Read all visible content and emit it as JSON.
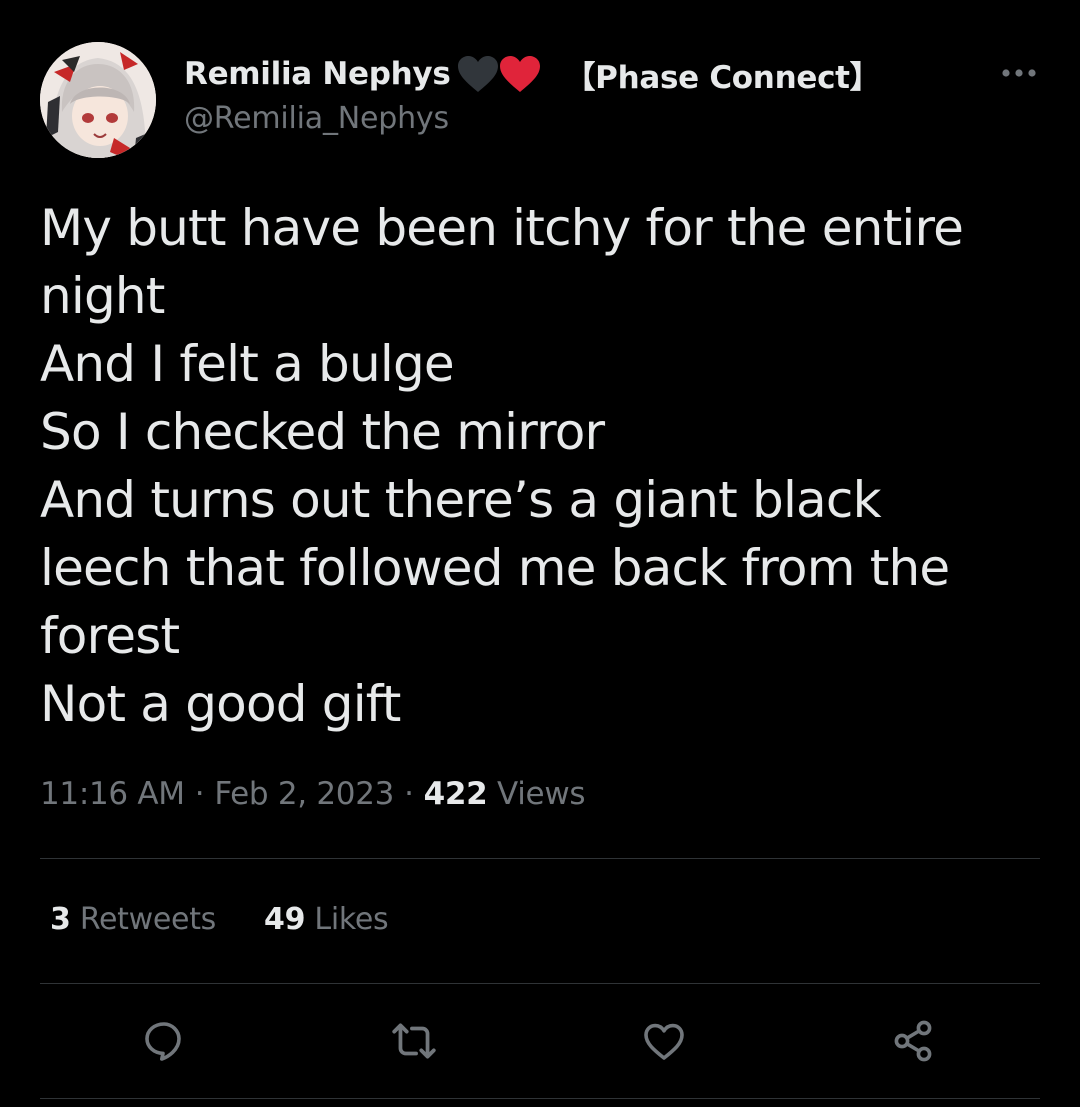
{
  "author": {
    "display_name": "Remilia Nephys",
    "tag": "【Phase Connect】",
    "handle": "@Remilia_Nephys",
    "emoji": [
      "black-heart-icon",
      "red-heart-icon"
    ]
  },
  "tweet": {
    "lines": [
      "My butt have been itchy for the entire",
      "night",
      "And I felt a bulge",
      "So I checked the mirror",
      "And turns out there’s a giant black",
      "leech that followed me back from the",
      "forest",
      "Not a good gift"
    ],
    "time": "11:16 AM",
    "date": "Feb 2, 2023",
    "separator": "·",
    "views_count": "422",
    "views_label": "Views"
  },
  "stats": {
    "retweets_count": "3",
    "retweets_label": "Retweets",
    "likes_count": "49",
    "likes_label": "Likes"
  },
  "actions": [
    "reply-icon",
    "retweet-icon",
    "like-icon",
    "share-icon"
  ],
  "colors": {
    "background": "#000000",
    "text_primary": "#e7e9ea",
    "text_secondary": "#71767b",
    "divider": "#2f3336",
    "red_heart": "#e0243a",
    "black_heart": "#31363b"
  }
}
